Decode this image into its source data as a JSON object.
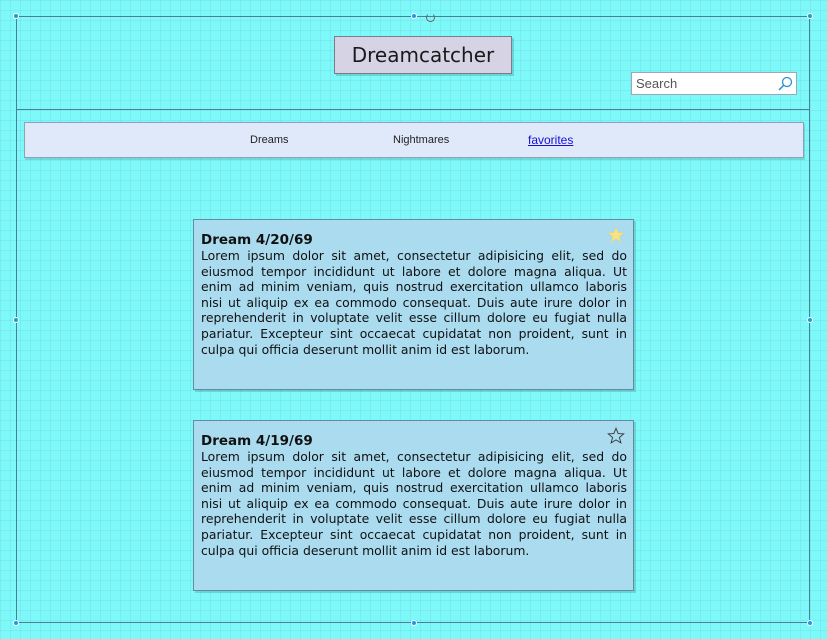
{
  "header": {
    "title": "Dreamcatcher"
  },
  "search": {
    "placeholder": "Search"
  },
  "nav": {
    "items": [
      {
        "label": "Dreams"
      },
      {
        "label": "Nightmares"
      },
      {
        "label": "favorites"
      }
    ]
  },
  "dreams": [
    {
      "title": "Dream 4/20/69",
      "body": "Lorem ipsum dolor sit amet, consectetur adipisicing elit, sed do eiusmod tempor incididunt ut labore et dolore magna aliqua. Ut enim ad minim veniam, quis nostrud exercitation ullamco laboris nisi ut aliquip ex ea commodo consequat. Duis aute irure dolor in reprehenderit in voluptate velit esse cillum dolore eu fugiat nulla pariatur. Excepteur sint occaecat cupidatat non proident, sunt in culpa qui officia deserunt mollit anim id est laborum.",
      "favorite": true,
      "star_icon": "star-filled-icon"
    },
    {
      "title": "Dream 4/19/69",
      "body": "Lorem ipsum dolor sit amet, consectetur adipisicing elit, sed do eiusmod tempor incididunt ut labore et dolore magna aliqua. Ut enim ad minim veniam, quis nostrud exercitation ullamco laboris nisi ut aliquip ex ea commodo consequat. Duis aute irure dolor in reprehenderit in voluptate velit esse cillum dolore eu fugiat nulla pariatur. Excepteur sint occaecat cupidatat non proident, sunt in culpa qui officia deserunt mollit anim id est laborum.",
      "favorite": false,
      "star_icon": "star-outline-icon"
    }
  ],
  "colors": {
    "background": "#7ef9f9",
    "card": "#aadbef",
    "nav": "#dfe9fa",
    "title_box": "#d6d3e5",
    "link": "#1a0dd8",
    "star_filled": "#f4e38a"
  }
}
